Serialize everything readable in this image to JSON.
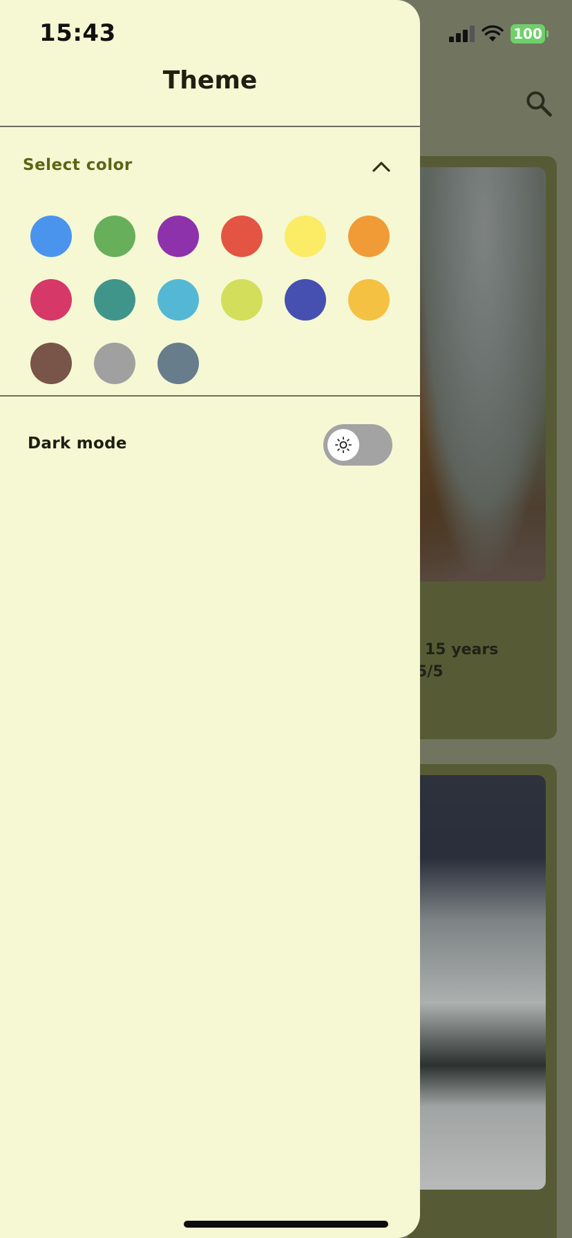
{
  "status_bar": {
    "time": "15:43",
    "battery": "100"
  },
  "drawer": {
    "title": "Theme",
    "select_color_label": "Select color",
    "colors": [
      "#4a94ee",
      "#67af5b",
      "#8e32ab",
      "#e45443",
      "#fceb64",
      "#f19b37",
      "#d63868",
      "#40958b",
      "#54b8d5",
      "#d3de5b",
      "#4550b1",
      "#f4c143",
      "#785548",
      "#a0a0a0",
      "#687d8b"
    ],
    "dark_mode_label": "Dark mode",
    "dark_mode_on": false
  },
  "background": {
    "card1_line1": "15 years",
    "card1_line2": "5/5"
  }
}
